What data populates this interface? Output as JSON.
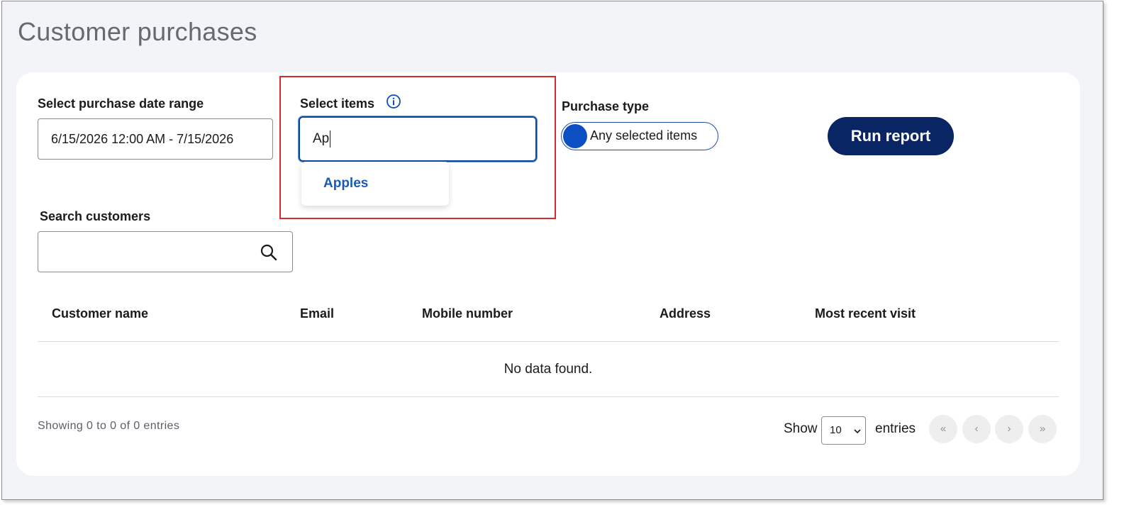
{
  "page": {
    "title": "Customer purchases"
  },
  "filters": {
    "date_range_label": "Select purchase date range",
    "date_range_value": "6/15/2026 12:00 AM - 7/15/2026",
    "items_label": "Select items",
    "items_input_value": "Ap",
    "items_suggestions": [
      "Apples"
    ],
    "purchase_type_label": "Purchase type",
    "purchase_type_toggle_label": "Any selected items",
    "run_report_label": "Run report",
    "search_customers_label": "Search customers",
    "search_customers_value": ""
  },
  "table": {
    "columns": [
      "Customer name",
      "Email",
      "Mobile number",
      "Address",
      "Most recent visit"
    ],
    "rows": [],
    "empty_message": "No data found."
  },
  "footer": {
    "showing_text": "Showing 0 to 0 of 0 entries",
    "show_label": "Show",
    "page_size": "10",
    "entries_label": "entries",
    "pagination": {
      "first": "«",
      "prev": "‹",
      "next": "›",
      "last": "»"
    }
  },
  "icons": {
    "info": "info-icon",
    "search": "search-icon",
    "select_chevron": "chevron-down-icon"
  },
  "colors": {
    "accent_blue": "#0b4fc2",
    "primary_button": "#0a2564",
    "highlight_box": "#d62b2b",
    "suggestion_text": "#1a5bb8"
  }
}
